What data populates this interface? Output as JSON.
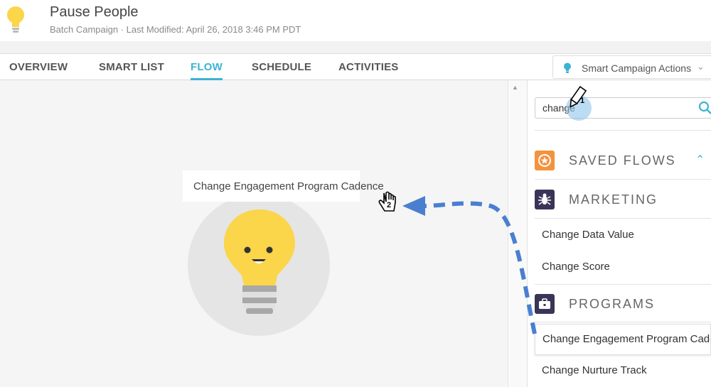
{
  "header": {
    "title": "Pause People",
    "subtitle": "Batch Campaign · Last Modified: April 26, 2018 3:46 PM PDT"
  },
  "tabs": [
    {
      "label": "OVERVIEW"
    },
    {
      "label": "SMART LIST"
    },
    {
      "label": "FLOW"
    },
    {
      "label": "SCHEDULE"
    },
    {
      "label": "ACTIVITIES"
    }
  ],
  "active_tab": "FLOW",
  "actions_menu": {
    "label": "Smart Campaign Actions",
    "icon": "lightbulb-icon"
  },
  "canvas": {
    "drop_label": "Change Engagement Program Cadence"
  },
  "sidebar": {
    "search_value": "change",
    "sections": [
      {
        "label": "SAVED FLOWS",
        "icon": "saved-flows-icon",
        "color": "#f5923e"
      },
      {
        "label": "MARKETING",
        "icon": "bug-icon",
        "color": "#3a3558"
      },
      {
        "label": "PROGRAMS",
        "icon": "briefcase-icon",
        "color": "#3a3558"
      }
    ],
    "marketing_items": [
      "Change Data Value",
      "Change Score"
    ],
    "program_items": [
      "Change Engagement Program Cadence",
      "Change Nurture Track"
    ]
  },
  "annotations": {
    "step1": "1",
    "step2": "2"
  },
  "colors": {
    "accent": "#3bb3d3",
    "bulb": "#fbd54a",
    "arrow": "#4a7fd0"
  }
}
